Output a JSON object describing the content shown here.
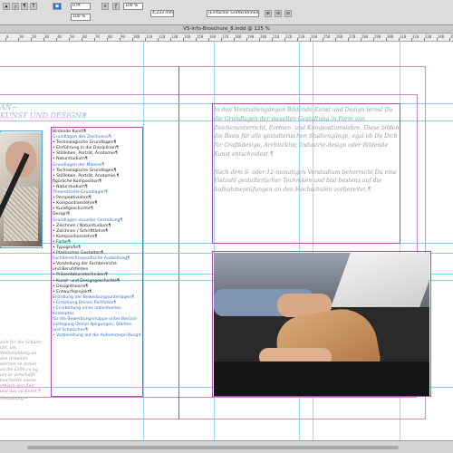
{
  "toolbar": {
    "paragraph_symbol": "¶",
    "text_tool": "T",
    "fill_box": "■",
    "stroke_weight": "0 Pt",
    "zoom_a": "100 %",
    "zoom_b": "100 %",
    "measure": "4,233 mm",
    "frame_fit": "[Einfacher Grafikrahmen]"
  },
  "titlebar": {
    "title": "VS-Info-Broschure_8.indd @ 125 %"
  },
  "ruler": {
    "ticks": [
      "0",
      "10",
      "20",
      "30",
      "40",
      "50",
      "60",
      "70",
      "80",
      "90",
      "100",
      "110",
      "120",
      "130",
      "140",
      "150",
      "160",
      "170",
      "180",
      "190",
      "200",
      "210",
      "220",
      "230",
      "240",
      "250",
      "260",
      "270",
      "280",
      "290",
      "300",
      "310",
      "320",
      "330",
      "340",
      "350",
      "360"
    ]
  },
  "page_left": {
    "heading_line1": "AN~",
    "heading_line2": "KUNST UND DESIGN#",
    "list_title": "Bildende Kunst¶",
    "items": [
      {
        "text": "Grundlagen des Zeichnens¶",
        "h": true
      },
      {
        "text": "• Technologische Grundlagen¶",
        "h": false
      },
      {
        "text": "• Einführung in die Disziplinen¶",
        "h": false
      },
      {
        "text": "• Stillleben, Porträt, Anatomie¶",
        "h": false
      },
      {
        "text": "• Naturstudium¶",
        "h": false
      },
      {
        "text": "Grundlagen der Malerei¶",
        "h": true
      },
      {
        "text": "• Technologische Grundlagen¶",
        "h": false
      },
      {
        "text": "• Stillleben, Porträt, Anatomie,¶",
        "h": false
      },
      {
        "text": "  figürliche Komposition¶",
        "h": false
      },
      {
        "text": "• Naturstudium¶",
        "h": false
      },
      {
        "text": "Theoretische Grundlagen¶",
        "h": true
      },
      {
        "text": "• Perspektivlehre¶",
        "h": false
      },
      {
        "text": "• Kompositionslehre¶",
        "h": false
      },
      {
        "text": "• Kunstgeschichte¶",
        "h": false
      },
      {
        "text": "Design¶",
        "h": false
      },
      {
        "text": "Grundlagen visueller Gestaltung¶",
        "h": true
      },
      {
        "text": "• Zeichnen / Naturstudium¶",
        "h": false
      },
      {
        "text": "• Zeichnen / Schrifttlehre¶",
        "h": false
      },
      {
        "text": "• Kompositionslehre¶",
        "h": false
      },
      {
        "text": "• Farbe¶",
        "h": false
      },
      {
        "text": "• Typografie¶",
        "h": false
      },
      {
        "text": "• Plastisches Gestalten¶",
        "h": false
      },
      {
        "text": "Fachbereichsspezifische Ausbildung¶",
        "h": true
      },
      {
        "text": "• Vorstellung der Fachbereiche",
        "h": false
      },
      {
        "text": "  und Berufsfelden",
        "h": false
      },
      {
        "text": "• Präsentationstechniken¶",
        "h": false
      },
      {
        "text": "• Kunst- und Designgeschichte¶",
        "h": false
      },
      {
        "text": "• Designtheorie¶",
        "h": false
      },
      {
        "text": "• Entwurfsprojekt¶",
        "h": false
      },
      {
        "text": "Erstellung der Bewerbungsunterlagen¶",
        "h": true
      },
      {
        "text": "• Erstellung Deines Portfolios¶",
        "h": true
      },
      {
        "text": "• Erarbeitung eines individuellen Konzeptes",
        "h": true
      },
      {
        "text": "  für die Bewerbungsmappe unter Berück-",
        "h": true
      },
      {
        "text": "  sichtigung Deiner Neigungen, Stärken",
        "h": true
      },
      {
        "text": "  und Schwächen¶",
        "h": true
      },
      {
        "text": "• Vorbereitung auf die Aufnahmeprüfung#",
        "h": true
      }
    ],
    "leftcol": "sich für die Schüler Ort, um Weiterbildung an den Arbeiten selchen se Arbeit an die £500 zu ng, um se verschafft bearbeitet meine ethisch gen Zeit und das nd Kunst.¶",
    "footer": "Gestaltung.~"
  },
  "page_right": {
    "para1": "In den Vorstudiengängen Bildende Kunst und Design lernst Du die Grundlagen der visuellen Gestaltung in Form von Zeichenunterricht, Formen- und Kompositionslehre. Diese bilden die Basis für alle gestalterischen Studiengänge, egal ob Du Dich für Grafikdesign, Architektur, Industrie-design oder Bildende Kunst entscheidest.¶",
    "para2": "Nach dem 6- oder 12-monatigen Vorstudium beherrscht Du eine Vielzahl gestalterischer Techniken und bist bestens auf die Aufnahmeprüfungen an den Hochschulen vorbereitet.¶"
  },
  "colors": {
    "guide": "#6cc8e6",
    "margin": "#c47ac0",
    "heading": "#9fb6d4",
    "link": "#3a6fc4"
  }
}
